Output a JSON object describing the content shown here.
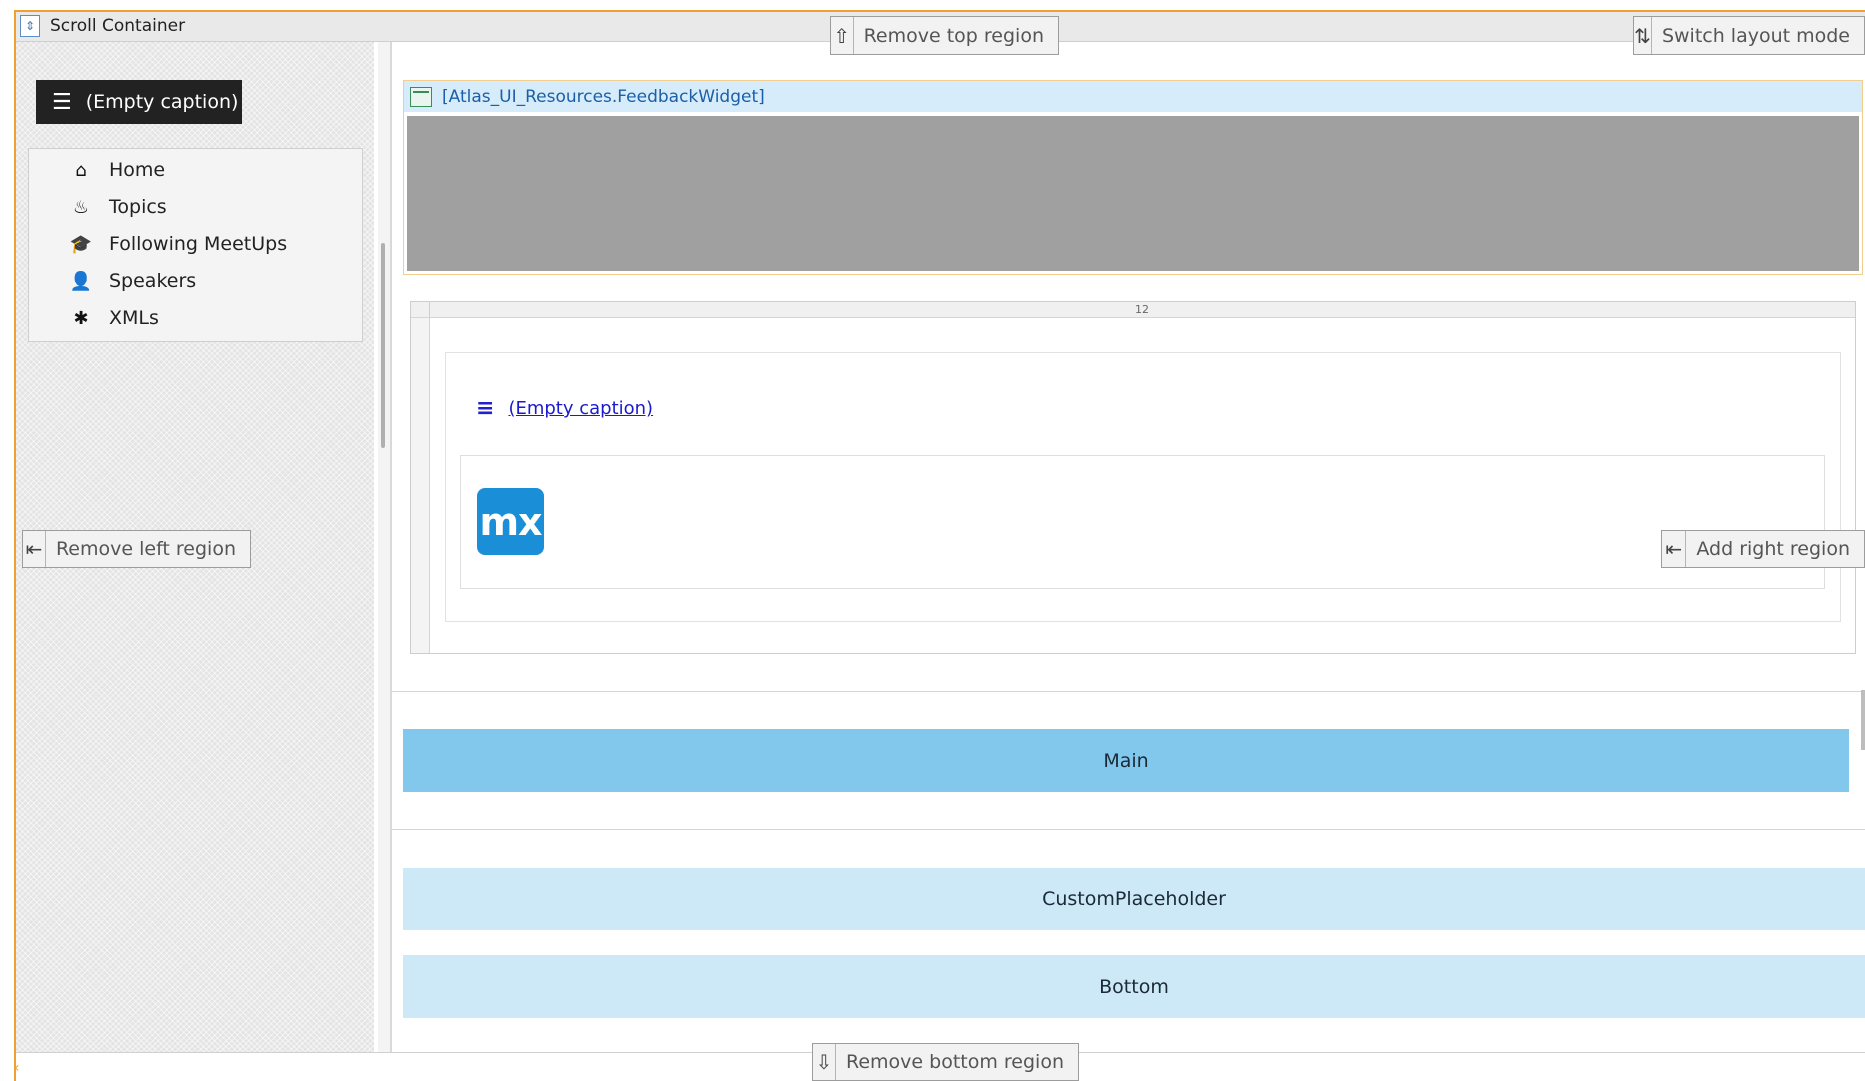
{
  "window": {
    "title": "Scroll Container"
  },
  "region_buttons": {
    "remove_top": "Remove top region",
    "switch_layout": "Switch layout mode",
    "remove_left": "Remove left region",
    "add_right": "Add right region",
    "remove_bottom": "Remove bottom region"
  },
  "sidebar": {
    "menu_toggle_label": "(Empty caption)",
    "items": [
      {
        "label": "Home",
        "icon": "home-icon",
        "glyph": "⌂"
      },
      {
        "label": "Topics",
        "icon": "fire-icon",
        "glyph": "♨"
      },
      {
        "label": "Following MeetUps",
        "icon": "graduation-cap-icon",
        "glyph": "🎓"
      },
      {
        "label": "Speakers",
        "icon": "user-icon",
        "glyph": "👤"
      },
      {
        "label": "XMLs",
        "icon": "asterisk-icon",
        "glyph": "✱"
      }
    ]
  },
  "main": {
    "feedback_widget_label": "[Atlas_UI_Resources.FeedbackWidget]",
    "layout_grid_column": "12",
    "caption_link": "(Empty caption)",
    "logo_text": "mx",
    "placeholders": {
      "main": "Main",
      "custom": "CustomPlaceholder",
      "bottom": "Bottom"
    }
  },
  "colors": {
    "frame_accent": "#f0a030",
    "main_placeholder": "#82c8ec",
    "light_placeholder": "#cde8f7",
    "mx_logo": "#1a8fd8"
  }
}
